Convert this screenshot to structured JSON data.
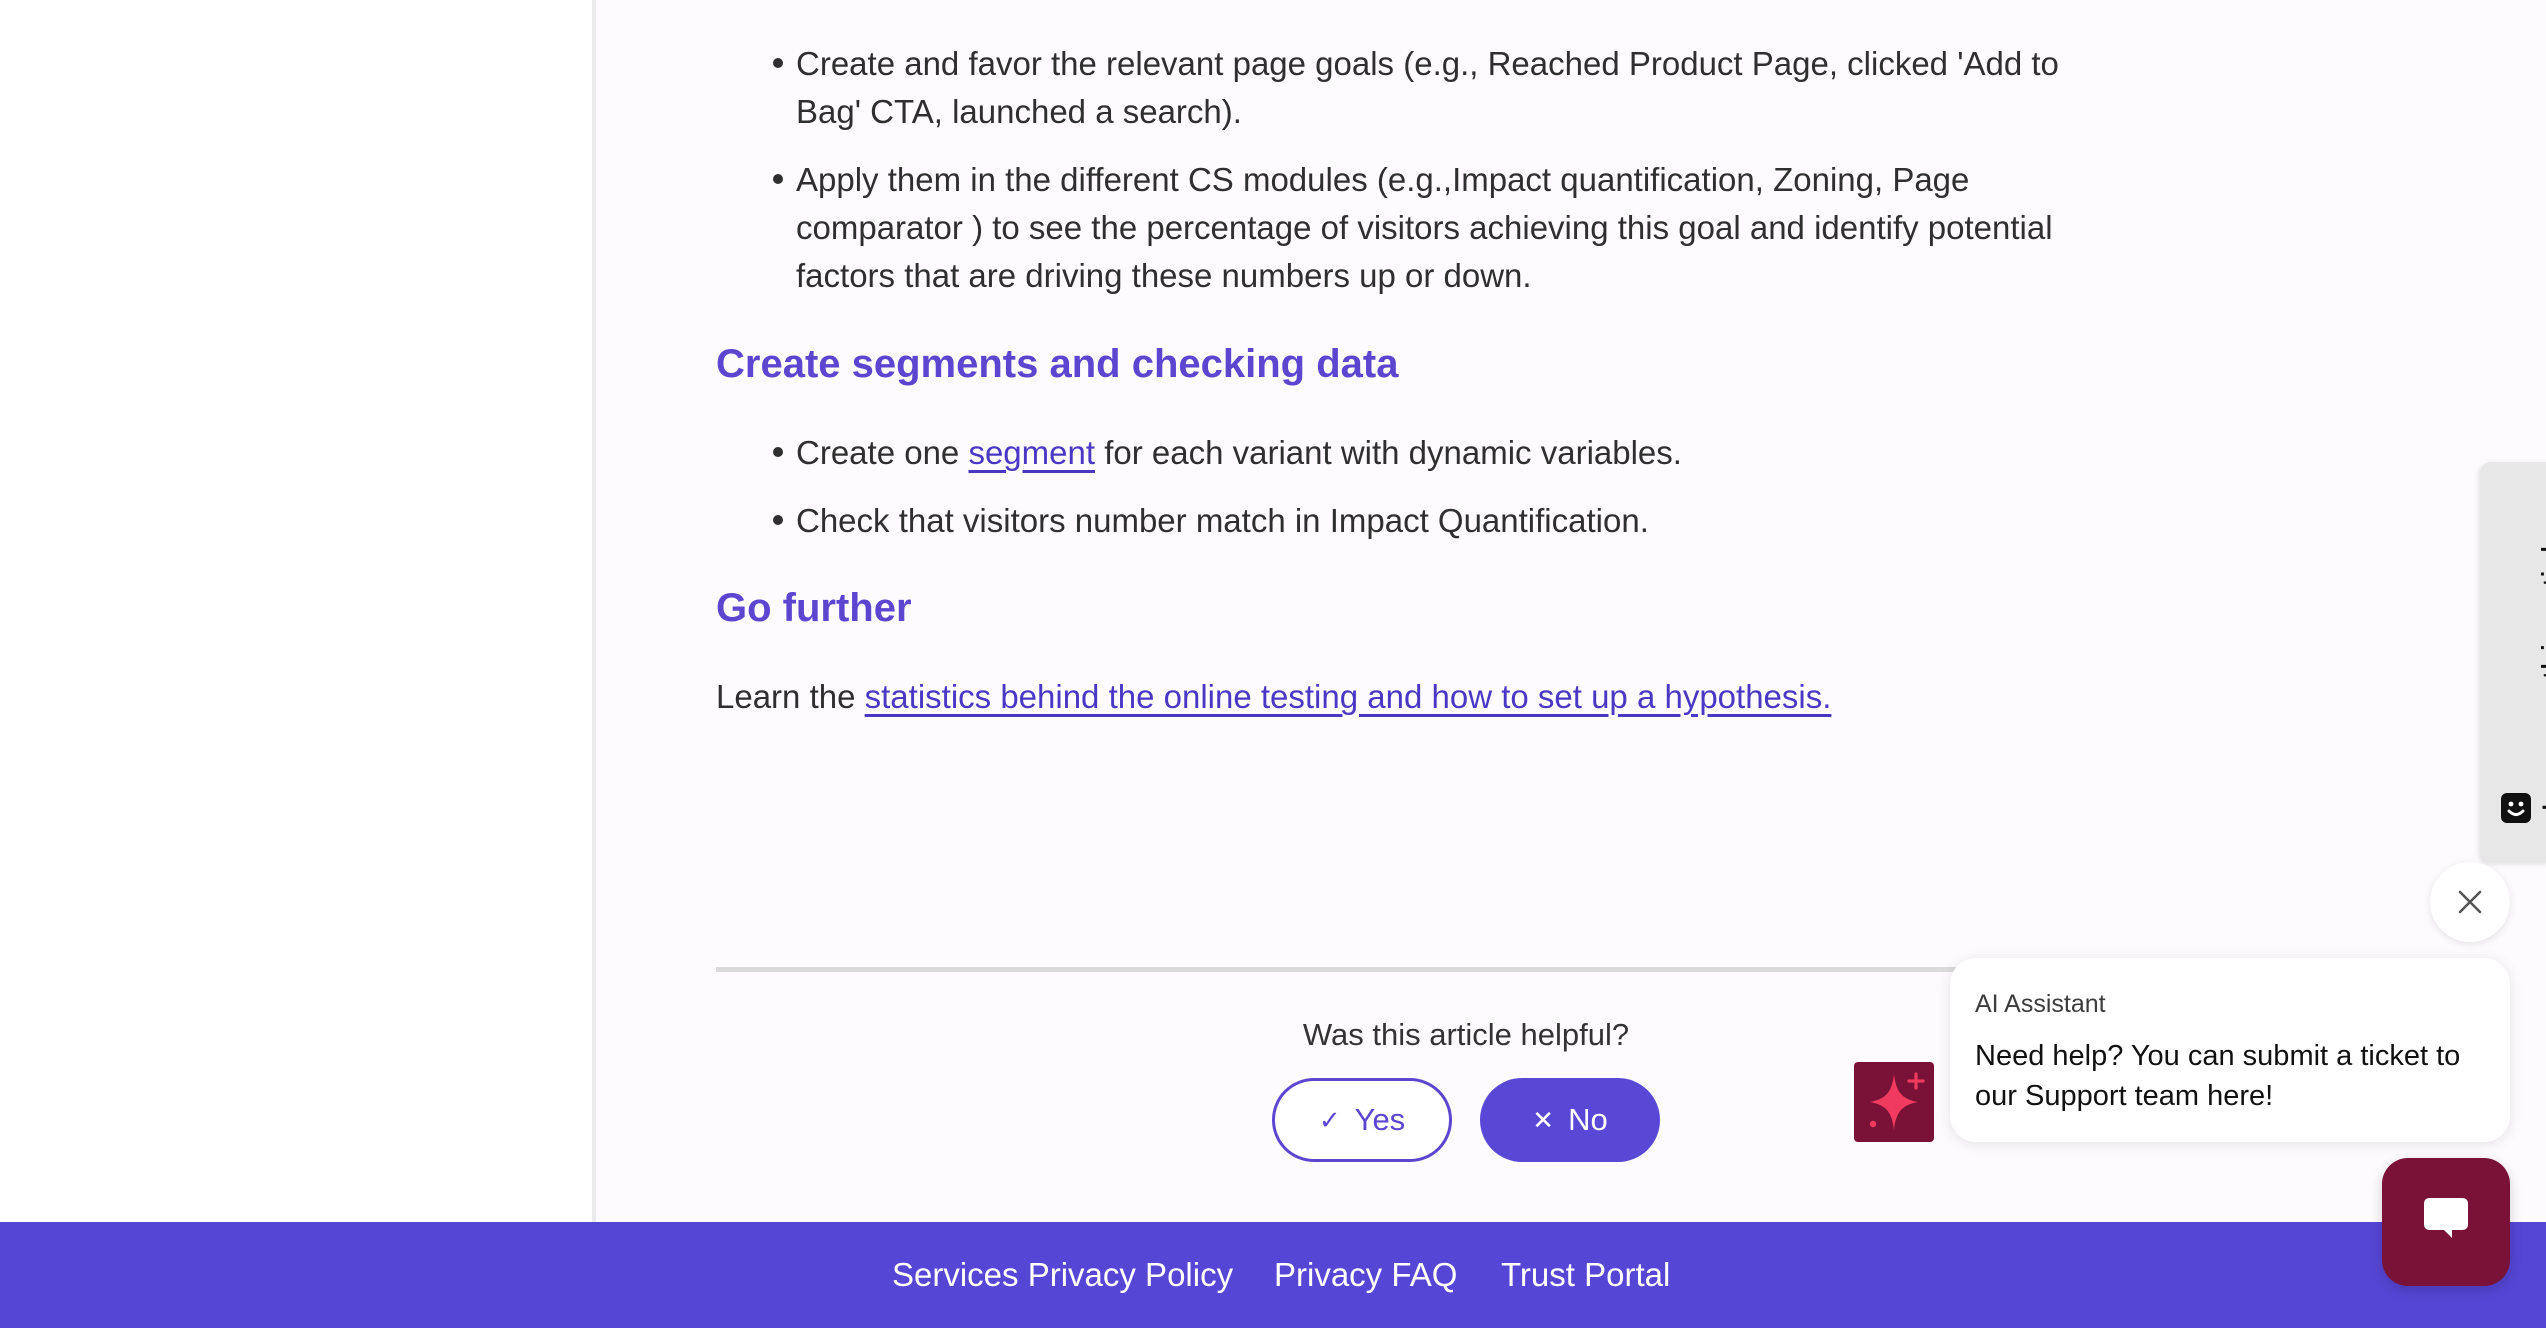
{
  "article": {
    "list1": [
      "Create and favor the relevant page goals (e.g., Reached Product Page, clicked 'Add to Bag' CTA, launched a search).",
      "Apply them in the different CS modules (e.g.,Impact quantification, Zoning, Page comparator ) to see the percentage of visitors achieving this goal and identify potential factors that are driving these numbers up or down."
    ],
    "heading_segments": "Create segments and checking data",
    "list2": {
      "item1_prefix": "Create one ",
      "item1_link": "segment",
      "item1_suffix": " for each variant with dynamic variables.",
      "item2": "Check that visitors number match in Impact Quantification."
    },
    "heading_further": "Go further",
    "learn_prefix": "Learn the ",
    "learn_link": "statistics behind the online testing and how to set up a hypothesis."
  },
  "feedback": {
    "question": "Was this article helpful?",
    "yes_label": "Yes",
    "no_label": "No",
    "yes_glyph": "✓",
    "no_glyph": "✕"
  },
  "improve_tab": {
    "label": "Improve this article"
  },
  "chat": {
    "sender": "AI Assistant",
    "message": "Need help? You can submit a ticket to our Support team here!"
  },
  "footer": {
    "links": [
      "Services Privacy Policy",
      "Privacy FAQ",
      "Trust Portal"
    ]
  },
  "colors": {
    "accent": "#5c46cf",
    "footer_bg": "#5646d6",
    "chat_brand": "#7a1136",
    "star": "#f03a5f"
  },
  "icons": [
    "check-icon",
    "x-icon",
    "smiley-icon",
    "close-icon",
    "sparkle-icon",
    "chat-bubble-icon"
  ]
}
